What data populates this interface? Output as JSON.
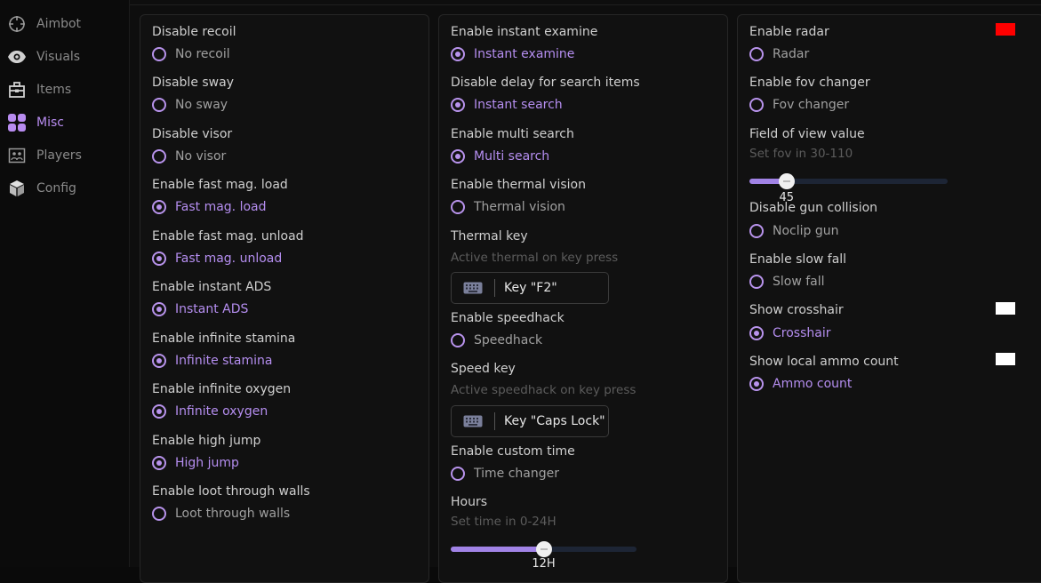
{
  "sidebar": {
    "items": [
      {
        "label": "Aimbot",
        "icon": "crosshair-icon"
      },
      {
        "label": "Visuals",
        "icon": "eye-icon"
      },
      {
        "label": "Items",
        "icon": "toolbox-icon"
      },
      {
        "label": "Misc",
        "icon": "grid-icon",
        "active": true
      },
      {
        "label": "Players",
        "icon": "players-icon"
      },
      {
        "label": "Config",
        "icon": "cube-icon"
      }
    ]
  },
  "col1": {
    "recoil": {
      "label": "Disable recoil",
      "option": "No recoil",
      "checked": false
    },
    "sway": {
      "label": "Disable sway",
      "option": "No sway",
      "checked": false
    },
    "visor": {
      "label": "Disable visor",
      "option": "No visor",
      "checked": false
    },
    "fastload": {
      "label": "Enable fast mag. load",
      "option": "Fast mag. load",
      "checked": true
    },
    "fastunload": {
      "label": "Enable fast mag. unload",
      "option": "Fast mag. unload",
      "checked": true
    },
    "ads": {
      "label": "Enable instant ADS",
      "option": "Instant ADS",
      "checked": true
    },
    "stamina": {
      "label": "Enable infinite stamina",
      "option": "Infinite stamina",
      "checked": true
    },
    "oxygen": {
      "label": "Enable infinite oxygen",
      "option": "Infinite oxygen",
      "checked": true
    },
    "jump": {
      "label": "Enable high jump",
      "option": "High jump",
      "checked": true
    },
    "loot": {
      "label": "Enable loot through walls",
      "option": "Loot through walls",
      "checked": false
    }
  },
  "col2": {
    "examine": {
      "label": "Enable instant examine",
      "option": "Instant examine",
      "checked": true
    },
    "search": {
      "label": "Disable delay for search items",
      "option": "Instant search",
      "checked": true
    },
    "multi": {
      "label": "Enable multi search",
      "option": "Multi search",
      "checked": true
    },
    "thermal": {
      "label": "Enable thermal vision",
      "option": "Thermal vision",
      "checked": false
    },
    "thermalkey": {
      "label": "Thermal key",
      "hint": "Active thermal on key press",
      "key": "Key \"F2\""
    },
    "speedhack": {
      "label": "Enable speedhack",
      "option": "Speedhack",
      "checked": false
    },
    "speedkey": {
      "label": "Speed key",
      "hint": "Active speedhack on key press",
      "key": "Key \"Caps Lock\""
    },
    "customtime": {
      "label": "Enable custom time",
      "option": "Time changer",
      "checked": false
    },
    "hours": {
      "label": "Hours",
      "hint": "Set time in 0-24H",
      "value_text": "12H",
      "value": 12,
      "min": 0,
      "max": 24
    }
  },
  "col3": {
    "radar": {
      "label": "Enable radar",
      "option": "Radar",
      "checked": false,
      "color": "#ff0000"
    },
    "fovchanger": {
      "label": "Enable fov changer",
      "option": "Fov changer",
      "checked": false
    },
    "fov": {
      "label": "Field of view value",
      "hint": "Set fov in 30-110",
      "value_text": "45",
      "value": 45,
      "min": 30,
      "max": 110
    },
    "gun": {
      "label": "Disable gun collision",
      "option": "Noclip gun",
      "checked": false
    },
    "slowfall": {
      "label": "Enable slow fall",
      "option": "Slow fall",
      "checked": false
    },
    "crosshair": {
      "label": "Show crosshair",
      "option": "Crosshair",
      "checked": true,
      "color": "#ffffff"
    },
    "ammo": {
      "label": "Show local ammo count",
      "option": "Ammo count",
      "checked": true,
      "color": "#ffffff"
    }
  },
  "colors": {
    "accent": "#b893ec",
    "slider_fill": "#a183e6",
    "slider_track": "#1d2535"
  }
}
